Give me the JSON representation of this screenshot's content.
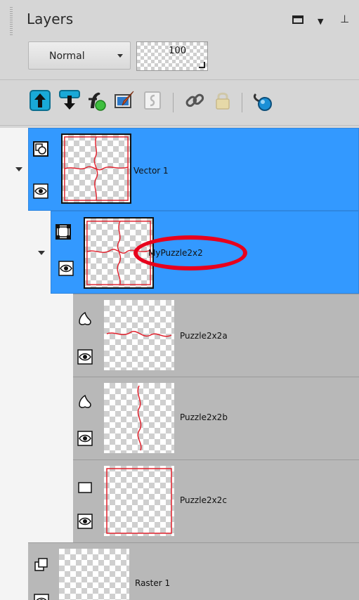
{
  "panel": {
    "title": "Layers"
  },
  "controls": {
    "blend_mode": "Normal",
    "opacity": "100"
  },
  "toolbar": {
    "tools": [
      "arrow-up-icon",
      "arrow-down-icon",
      "layer-fx-icon",
      "layer-brush-icon",
      "script-icon",
      "link-icon",
      "lock-icon",
      "globe-link-icon"
    ]
  },
  "layers": [
    {
      "name": "Vector 1",
      "type": "vector",
      "selected": true
    },
    {
      "name": "MyPuzzle2x2",
      "type": "group",
      "selected": true
    },
    {
      "name": "Puzzle2x2a",
      "type": "shape",
      "selected": false
    },
    {
      "name": "Puzzle2x2b",
      "type": "shape",
      "selected": false
    },
    {
      "name": "Puzzle2x2c",
      "type": "rectangle",
      "selected": false
    },
    {
      "name": "Raster 1",
      "type": "raster",
      "selected": false
    }
  ],
  "colors": {
    "selection": "#3399ff",
    "annotation": "#e8001c",
    "puzzle_line": "#e0202c"
  }
}
